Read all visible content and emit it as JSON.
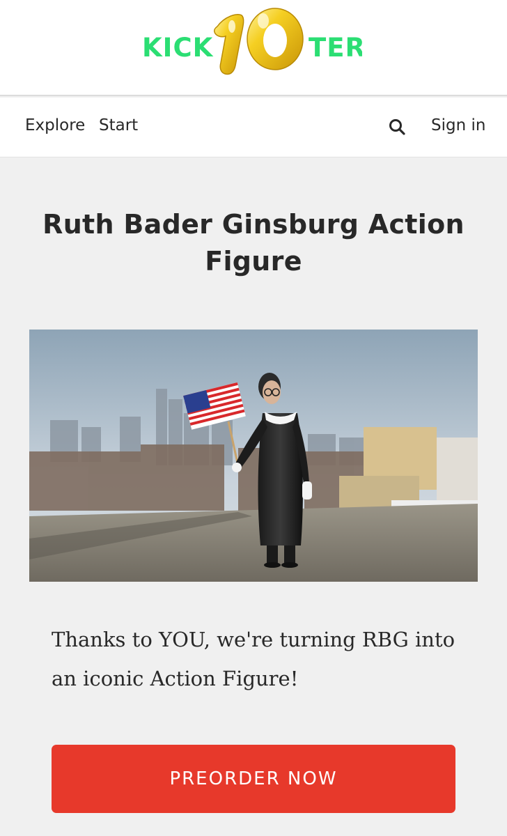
{
  "brand": {
    "logo_text_left": "KICK",
    "logo_text_right": "TER",
    "anniversary_number": "10",
    "logo_color": "#2bde73",
    "balloon_color": "#f2c514"
  },
  "nav": {
    "explore": "Explore",
    "start": "Start",
    "search_icon": "search-icon",
    "sign_in": "Sign in"
  },
  "project": {
    "title": "Ruth Bader Ginsburg Action Figure",
    "image_subject": "action figure holding US flag on a rooftop with city skyline",
    "blurb": "Thanks to YOU, we're turning RBG into an iconic Action Figure!"
  },
  "cta": {
    "label": "PREORDER NOW",
    "color": "#e7392b"
  }
}
